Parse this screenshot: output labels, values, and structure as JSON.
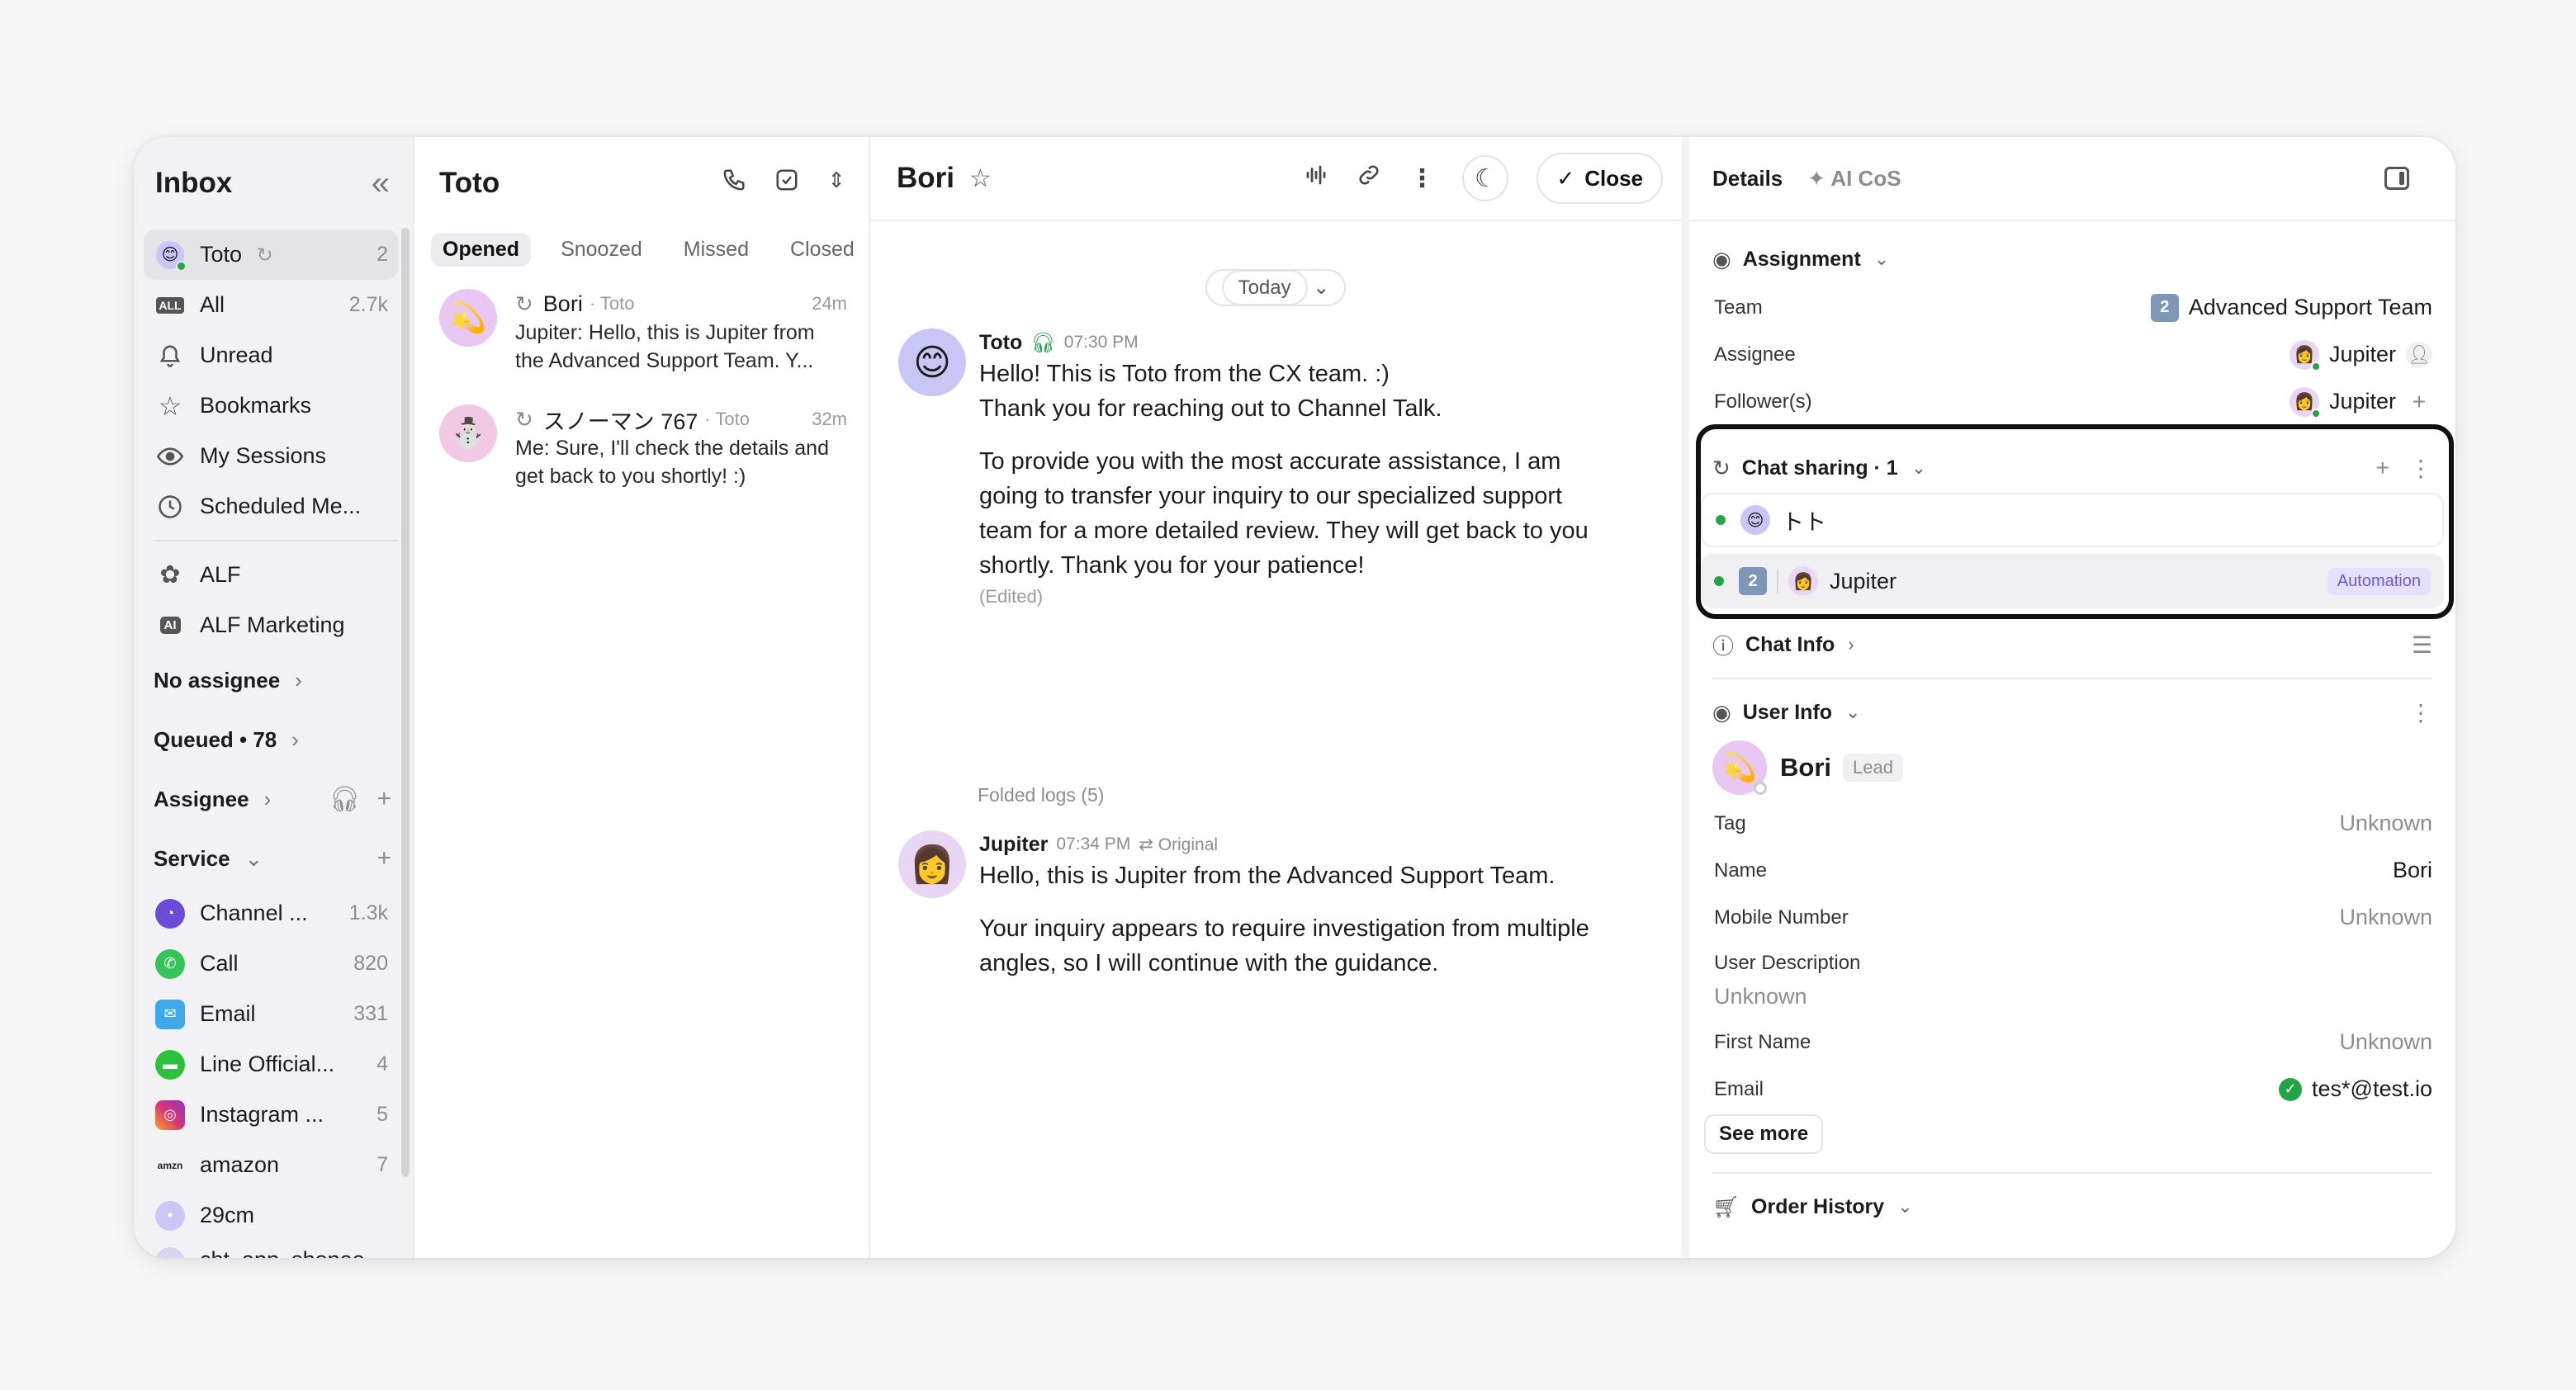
{
  "sidebar": {
    "title": "Inbox",
    "nav": [
      {
        "label": "Toto",
        "count": "2"
      },
      {
        "label": "All",
        "count": "2.7k"
      },
      {
        "label": "Unread",
        "count": ""
      },
      {
        "label": "Bookmarks",
        "count": ""
      },
      {
        "label": "My Sessions",
        "count": ""
      },
      {
        "label": "Scheduled Me...",
        "count": ""
      }
    ],
    "alf": [
      {
        "label": "ALF"
      },
      {
        "label": "ALF Marketing"
      }
    ],
    "groups": {
      "no_assignee": "No assignee",
      "queued": "Queued • 78",
      "assignee": "Assignee",
      "service": "Service"
    },
    "services": [
      {
        "label": "Channel ...",
        "count": "1.3k",
        "color": "#6b4bd8"
      },
      {
        "label": "Call",
        "count": "820",
        "color": "#35c35a"
      },
      {
        "label": "Email",
        "count": "331",
        "color": "#3fa8ea"
      },
      {
        "label": "Line Official...",
        "count": "4",
        "color": "#2cc13d"
      },
      {
        "label": "Instagram ...",
        "count": "5",
        "color": "#d8327a"
      },
      {
        "label": "amazon",
        "count": "7",
        "color": "#222222"
      },
      {
        "label": "29cm",
        "count": "",
        "color": "#c9c7f5"
      },
      {
        "label": "cht_app_shopee",
        "count": "",
        "color": "#d7d5f3"
      }
    ]
  },
  "chatlist": {
    "title": "Toto",
    "tabs": [
      "Opened",
      "Snoozed",
      "Missed",
      "Closed"
    ],
    "chats": [
      {
        "name": "Bori",
        "sub": "· Toto",
        "time": "24m",
        "preview": "Jupiter: Hello, this is Jupiter from the Advanced Support Team. Y..."
      },
      {
        "name": "スノーマン 767",
        "sub": "· Toto",
        "time": "32m",
        "preview": "Me: Sure, I'll check the details and get back to you shortly! :)"
      }
    ]
  },
  "conversation": {
    "title": "Bori",
    "close_label": "Close",
    "today_label": "Today",
    "messages": [
      {
        "sender": "Toto",
        "time": "07:30 PM",
        "paragraphs": [
          "Hello! This is Toto from the CX team. :)",
          "Thank you for reaching out to Channel Talk.",
          "To provide you with the most accurate assistance, I am going to transfer your inquiry to our specialized support team for a more detailed review. They will get back to you shortly. Thank you for your patience!"
        ],
        "edited": "(Edited)"
      },
      {
        "sender": "Jupiter",
        "time": "07:34 PM",
        "original": "Original",
        "paragraphs": [
          "Hello, this is Jupiter from the Advanced Support Team.",
          "Your inquiry appears to require investigation from multiple angles, so I will continue with the guidance."
        ]
      }
    ],
    "folded_logs": "Folded logs (5)"
  },
  "details": {
    "tabs": [
      "Details",
      "AI CoS"
    ],
    "assignment": {
      "title": "Assignment",
      "team_label": "Team",
      "team_badge": "2",
      "team_value": "Advanced Support Team",
      "assignee_label": "Assignee",
      "assignee_value": "Jupiter",
      "follower_label": "Follower(s)",
      "follower_value": "Jupiter"
    },
    "chat_sharing": {
      "title": "Chat sharing · 1",
      "rows": [
        {
          "name": "トト"
        },
        {
          "badge": "2",
          "name": "Jupiter",
          "tag": "Automation"
        }
      ]
    },
    "chat_info": {
      "title": "Chat Info"
    },
    "user_info": {
      "title": "User Info",
      "name": "Bori",
      "badge": "Lead",
      "fields": [
        {
          "label": "Tag",
          "value": "Unknown"
        },
        {
          "label": "Name",
          "value": "Bori"
        },
        {
          "label": "Mobile Number",
          "value": "Unknown"
        },
        {
          "label": "User Description",
          "value": "Unknown"
        },
        {
          "label": "First Name",
          "value": "Unknown"
        },
        {
          "label": "Email",
          "value": "tes*@test.io"
        }
      ],
      "see_more": "See more"
    },
    "order_history": {
      "title": "Order History"
    }
  }
}
